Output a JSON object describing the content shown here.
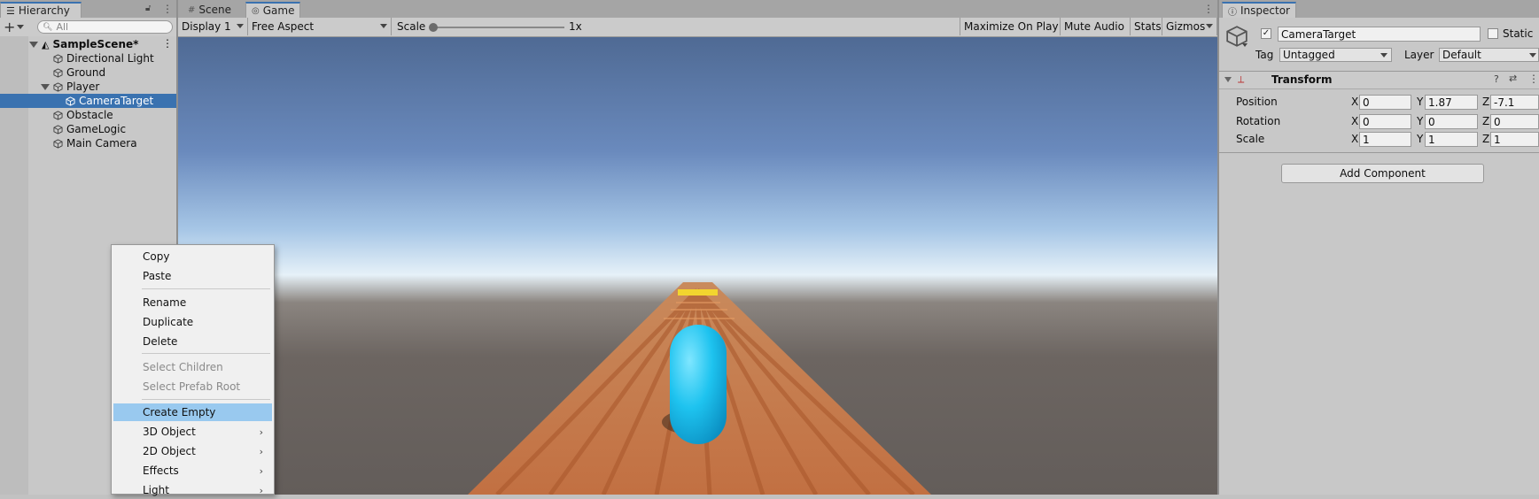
{
  "hierarchy": {
    "tab_title": "Hierarchy",
    "search_placeholder": "All",
    "scene_name": "SampleScene*",
    "items": [
      {
        "label": "Directional Light"
      },
      {
        "label": "Ground"
      },
      {
        "label": "Player"
      },
      {
        "label": "CameraTarget"
      },
      {
        "label": "Obstacle"
      },
      {
        "label": "GameLogic"
      },
      {
        "label": "Main Camera"
      }
    ]
  },
  "game_view": {
    "tabs": [
      {
        "label": "Scene"
      },
      {
        "label": "Game"
      }
    ],
    "display": "Display 1",
    "aspect": "Free Aspect",
    "scale_label": "Scale",
    "scale_value": "1x",
    "buttons": {
      "maximize": "Maximize On Play",
      "mute": "Mute Audio",
      "stats": "Stats",
      "gizmos": "Gizmos"
    }
  },
  "context_menu": {
    "items": [
      {
        "label": "Copy"
      },
      {
        "label": "Paste"
      },
      {
        "label": "Rename"
      },
      {
        "label": "Duplicate"
      },
      {
        "label": "Delete"
      },
      {
        "label": "Select Children"
      },
      {
        "label": "Select Prefab Root"
      },
      {
        "label": "Create Empty"
      },
      {
        "label": "3D Object"
      },
      {
        "label": "2D Object"
      },
      {
        "label": "Effects"
      },
      {
        "label": "Light"
      }
    ]
  },
  "inspector": {
    "tab_title": "Inspector",
    "object_name": "CameraTarget",
    "static_label": "Static",
    "tag_label": "Tag",
    "tag_value": "Untagged",
    "layer_label": "Layer",
    "layer_value": "Default",
    "component_title": "Transform",
    "position_label": "Position",
    "rotation_label": "Rotation",
    "scale_label": "Scale",
    "axis_x": "X",
    "axis_y": "Y",
    "axis_z": "Z",
    "position": {
      "x": "0",
      "y": "1.87",
      "z": "-7.1"
    },
    "rotation": {
      "x": "0",
      "y": "0",
      "z": "0"
    },
    "scale": {
      "x": "1",
      "y": "1",
      "z": "1"
    },
    "add_component": "Add Component"
  },
  "colors": {
    "selection": "#3a72b0",
    "menu_highlight": "#99c9ef",
    "player_capsule": "#1ec3ef",
    "runway": "#d98a4f"
  },
  "icons": [
    "list-icon",
    "lock-icon",
    "kebab-icon",
    "plus-icon",
    "search-icon",
    "unity-scene-icon",
    "gameobject-cube-icon",
    "grid-icon",
    "gamepad-icon",
    "info-icon",
    "transform-axes-icon",
    "help-icon",
    "presets-icon"
  ]
}
